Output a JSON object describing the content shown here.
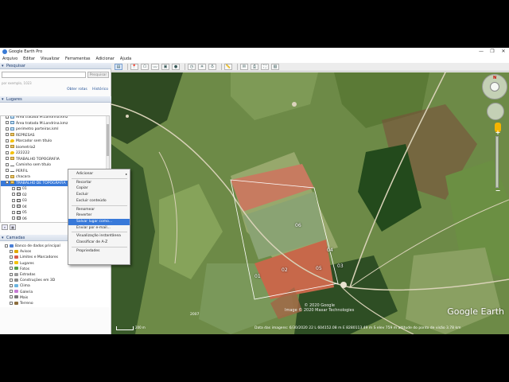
{
  "window": {
    "title": "Google Earth Pro",
    "controls": [
      "—",
      "❐",
      "✕"
    ]
  },
  "menu": [
    "Arquivo",
    "Editar",
    "Visualizar",
    "Ferramentas",
    "Adicionar",
    "Ajuda"
  ],
  "search": {
    "header": "Pesquisar",
    "placeholder": "",
    "button": "Pesquisar",
    "hint": "por exemplo, 1023",
    "links": [
      "Obter rotas",
      "Histórico"
    ]
  },
  "places": {
    "header": "Lugares",
    "items": [
      {
        "label": "Área tratada M.Londrina.kmz",
        "icon": "kml-icon",
        "checked": true
      },
      {
        "label": "Área tratada M.Londrina.kmz",
        "icon": "kml-icon",
        "checked": true
      },
      {
        "label": "perimetro porteiras.kml",
        "icon": "kml-icon",
        "checked": true
      },
      {
        "label": "REPRESAS",
        "icon": "folder-icon",
        "checked": true
      },
      {
        "label": "Marcador sem título",
        "icon": "placemark-icon",
        "checked": true
      },
      {
        "label": "biometria2",
        "icon": "folder-icon",
        "checked": true
      },
      {
        "label": "222222",
        "icon": "placemark-icon",
        "checked": true
      },
      {
        "label": "TRABALHO TOPOGRAFIA",
        "icon": "folder-icon",
        "checked": true
      },
      {
        "label": "Caminho sem título",
        "icon": "path-icon",
        "checked": true
      },
      {
        "label": "PERFIL",
        "icon": "path-icon",
        "checked": false
      },
      {
        "label": "chacara",
        "icon": "folder-icon",
        "checked": true
      },
      {
        "label": "TRABALHO DE TOPOGRAFIA",
        "icon": "folder-icon",
        "checked": true,
        "selected": true
      },
      {
        "label": "01",
        "icon": "polygon-icon",
        "checked": true,
        "indent": true
      },
      {
        "label": "02",
        "icon": "polygon-icon",
        "checked": true,
        "indent": true
      },
      {
        "label": "03",
        "icon": "polygon-icon",
        "checked": true,
        "indent": true
      },
      {
        "label": "04",
        "icon": "polygon-icon",
        "checked": true,
        "indent": true
      },
      {
        "label": "05",
        "icon": "polygon-icon",
        "checked": true,
        "indent": true
      },
      {
        "label": "06",
        "icon": "polygon-icon",
        "checked": true,
        "indent": true
      }
    ]
  },
  "layers": {
    "header": "Camadas",
    "items": [
      {
        "label": "Banco de dados principal",
        "icon": "globe-icon"
      },
      {
        "label": "Avisos",
        "icon": "alert-icon"
      },
      {
        "label": "Limites e Marcadores",
        "icon": "borders-icon"
      },
      {
        "label": "Lugares",
        "icon": "places-icon"
      },
      {
        "label": "Fotos",
        "icon": "photo-icon"
      },
      {
        "label": "Estradas",
        "icon": "road-icon"
      },
      {
        "label": "Construções em 3D",
        "icon": "building-icon"
      },
      {
        "label": "Clima",
        "icon": "weather-icon"
      },
      {
        "label": "Galeria",
        "icon": "gallery-icon"
      },
      {
        "label": "Mais",
        "icon": "more-icon"
      },
      {
        "label": "Terreno",
        "icon": "terrain-icon"
      }
    ]
  },
  "context_menu": {
    "items": [
      {
        "label": "Adicionar",
        "submenu": true
      },
      {
        "sep": true
      },
      {
        "label": "Recortar"
      },
      {
        "label": "Copiar"
      },
      {
        "label": "Excluir"
      },
      {
        "label": "Excluir conteúdo"
      },
      {
        "sep": true
      },
      {
        "label": "Renomear"
      },
      {
        "label": "Reverter"
      },
      {
        "label": "Salvar lugar como...",
        "highlighted": true
      },
      {
        "label": "Enviar por e-mail..."
      },
      {
        "sep": true
      },
      {
        "label": "Visualização instantânea"
      },
      {
        "label": "Classificar de A-Z"
      },
      {
        "sep": true
      },
      {
        "label": "Propriedades"
      }
    ]
  },
  "map": {
    "polygon_labels": [
      "06",
      "04",
      "05",
      "03",
      "02",
      "01"
    ],
    "watermark": "Google Earth",
    "copyright_line1": "© 2020 Google",
    "copyright_line2": "Image © 2020 Maxar Technologies",
    "year": "2007",
    "status": "Data das imagens: 6/30/2020    22 L 604152.08 m E 8280113.49 m S   elev  759 m      altitude do ponto de visão  3.78 km",
    "scale": "200 m"
  }
}
